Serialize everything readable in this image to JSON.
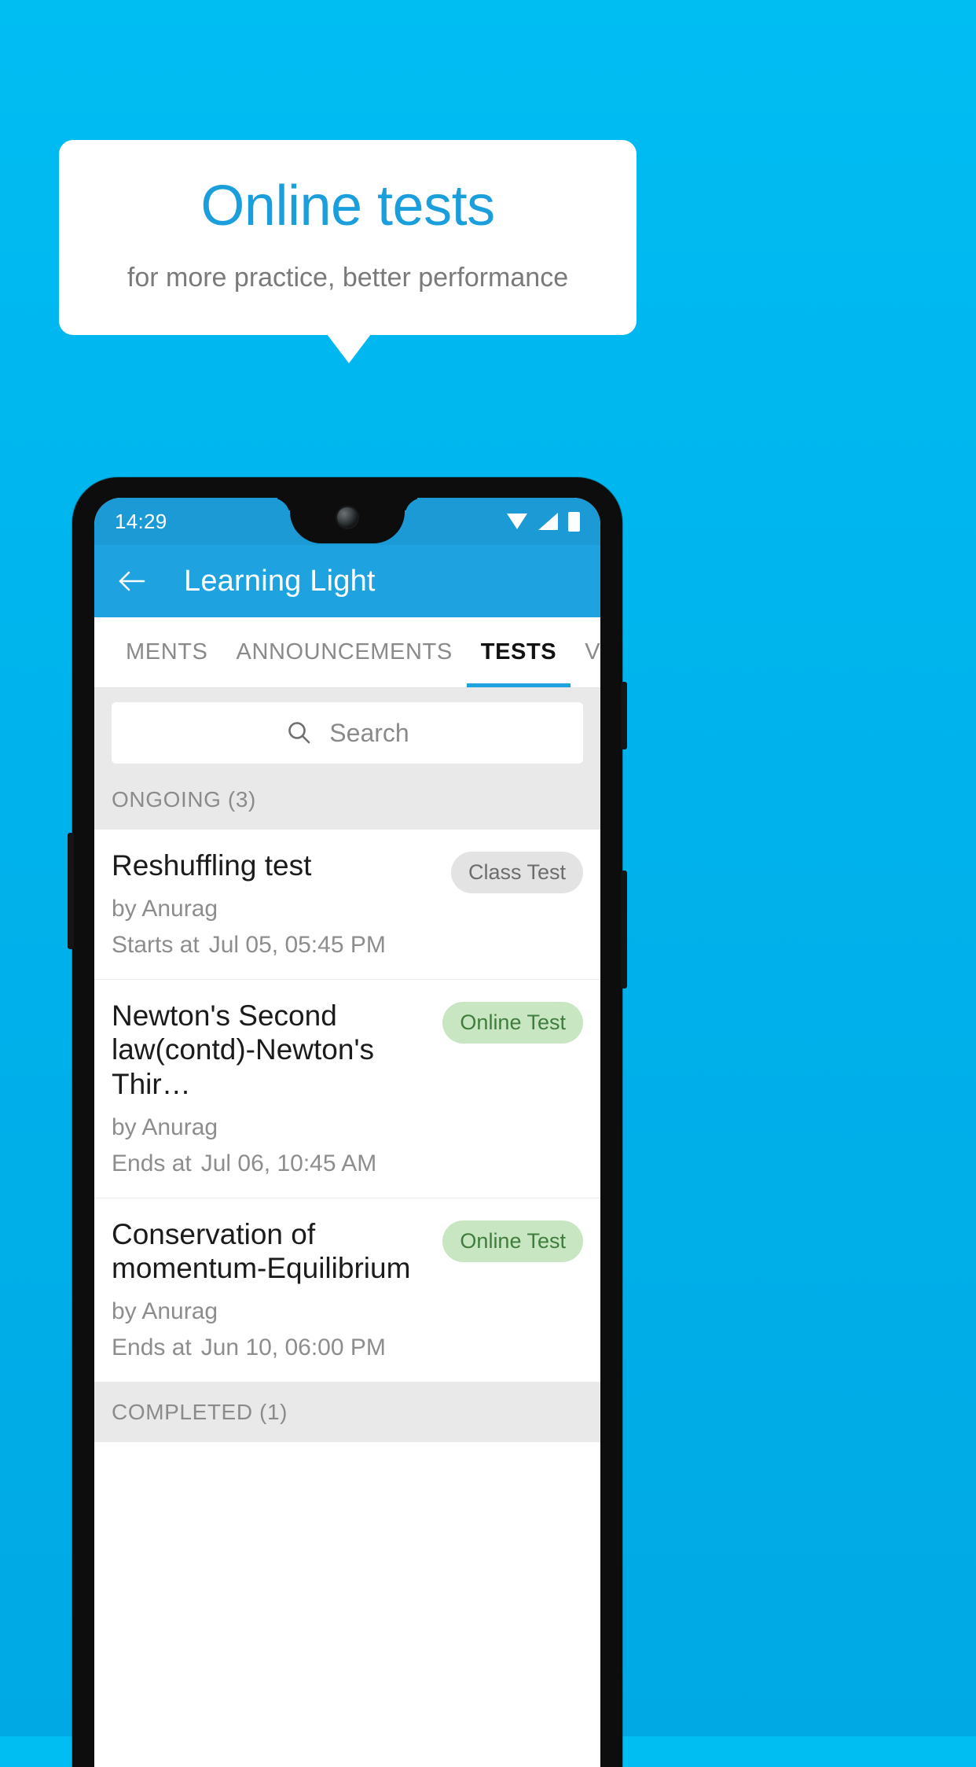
{
  "promo": {
    "title": "Online tests",
    "subtitle": "for more practice, better performance",
    "title_color": "#1a9fdc",
    "background_color": "#00b3ec"
  },
  "phone": {
    "status_bar": {
      "time": "14:29",
      "icons": [
        "wifi-icon",
        "signal-icon",
        "battery-icon"
      ]
    },
    "app_bar": {
      "back_icon": "back-arrow-icon",
      "title": "Learning Light"
    },
    "tabs": {
      "items": [
        {
          "label": "MENTS",
          "active": false
        },
        {
          "label": "ANNOUNCEMENTS",
          "active": false
        },
        {
          "label": "TESTS",
          "active": true
        },
        {
          "label": "VIDEOS",
          "active": false
        }
      ],
      "active_index": 2,
      "indicator_color": "#1ea3e0"
    },
    "search": {
      "icon": "search-icon",
      "placeholder": "Search",
      "value": ""
    },
    "sections": [
      {
        "header": "ONGOING (3)",
        "items": [
          {
            "title": "Reshuffling test",
            "author": "by Anurag",
            "when_label": "Starts at",
            "when_value": "Jul 05, 05:45 PM",
            "badge": "Class Test",
            "badge_type": "class"
          },
          {
            "title": "Newton's Second law(contd)-Newton's Thir…",
            "author": "by Anurag",
            "when_label": "Ends at",
            "when_value": "Jul 06, 10:45 AM",
            "badge": "Online Test",
            "badge_type": "online"
          },
          {
            "title": "Conservation of momentum-Equilibrium",
            "author": "by Anurag",
            "when_label": "Ends at",
            "when_value": "Jun 10, 06:00 PM",
            "badge": "Online Test",
            "badge_type": "online"
          }
        ]
      },
      {
        "header": "COMPLETED (1)",
        "items": []
      }
    ]
  }
}
